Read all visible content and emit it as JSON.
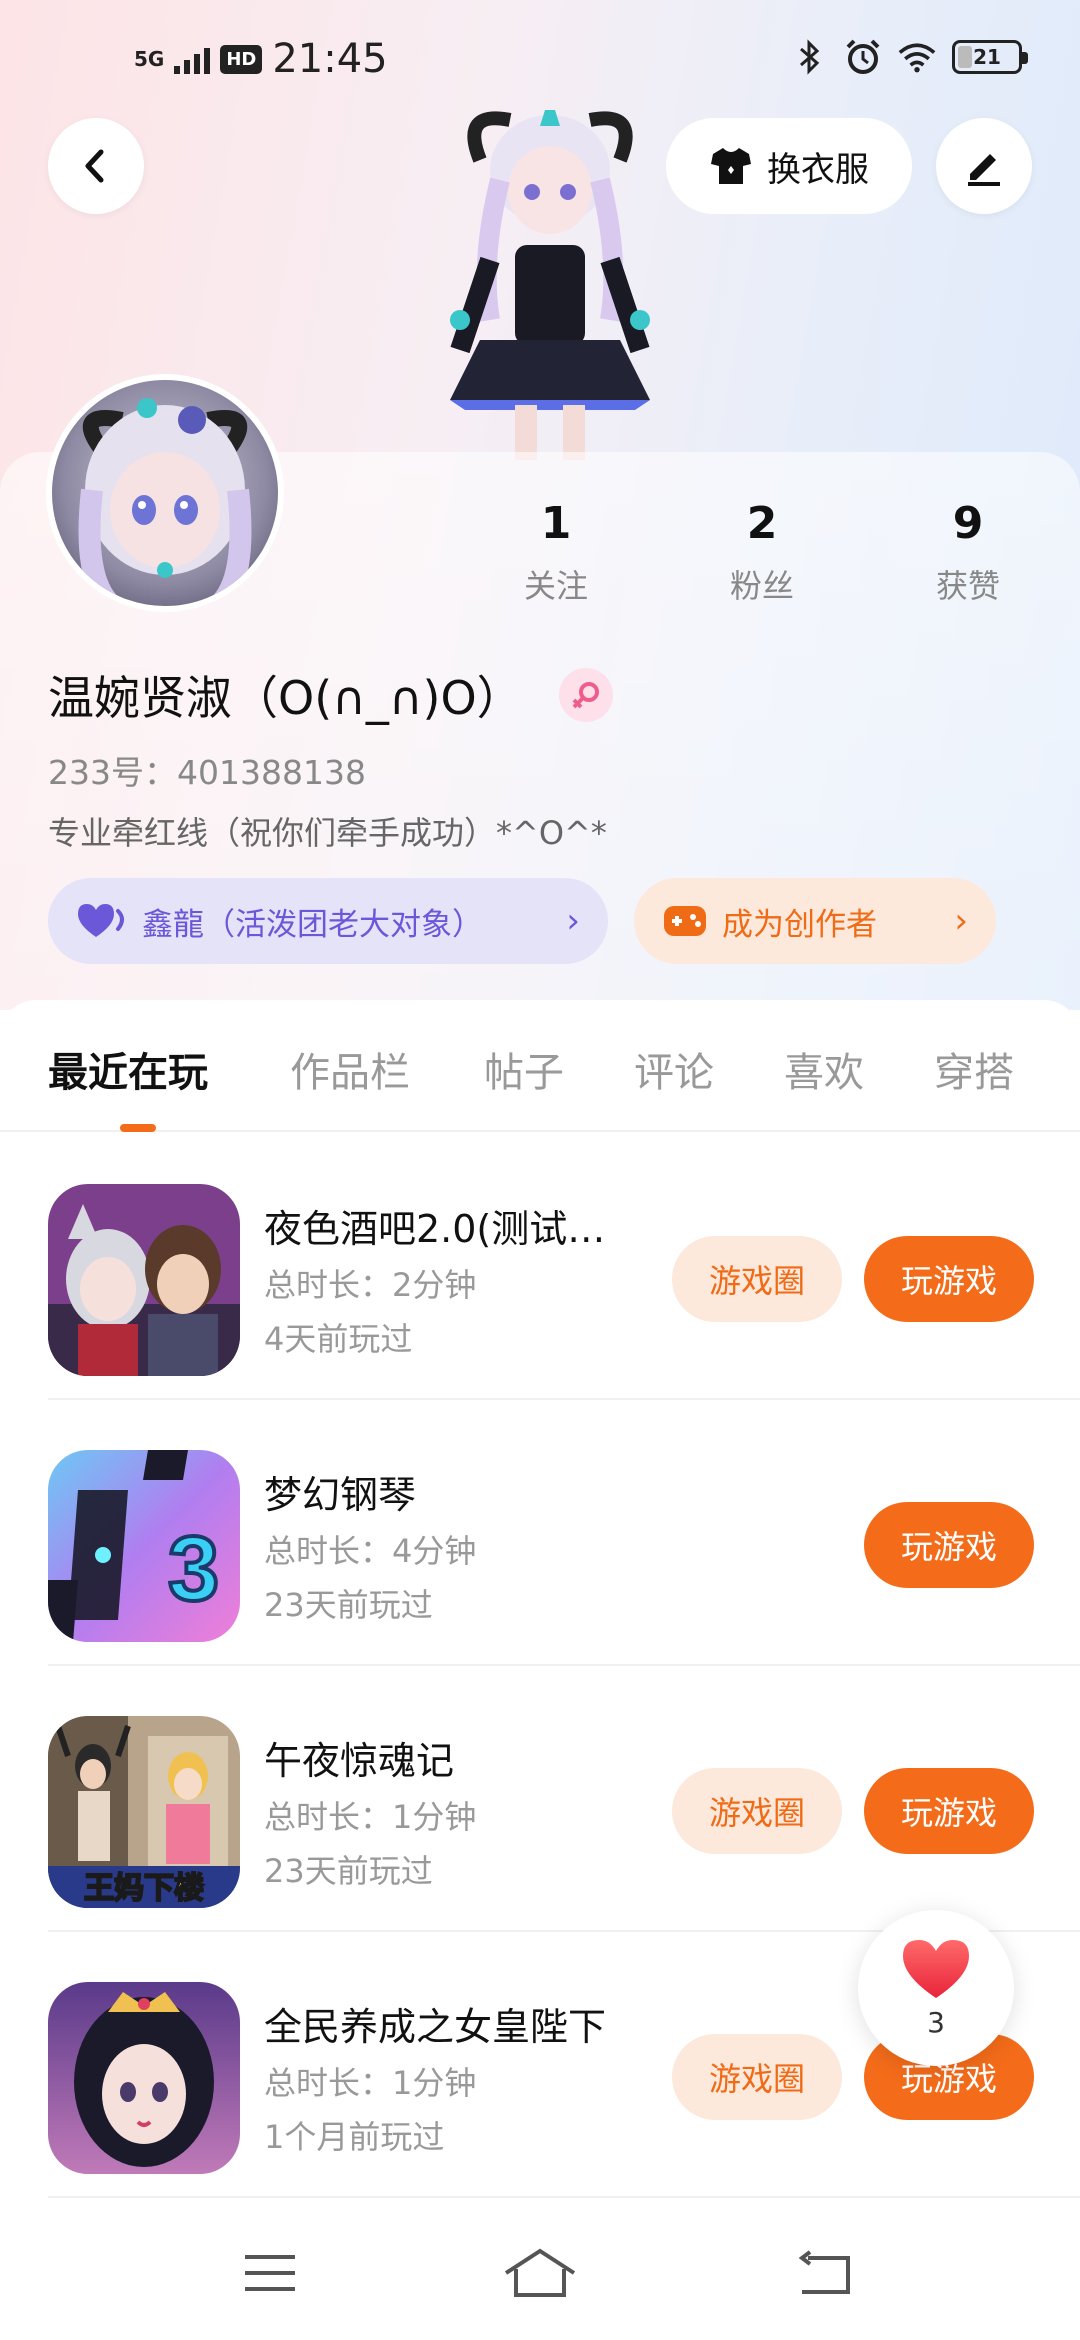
{
  "status_bar": {
    "signal": "5G",
    "hd": "HD",
    "time": "21:45",
    "battery": "21"
  },
  "header": {
    "outfit_label": "换衣服"
  },
  "profile": {
    "username": "温婉贤淑（O(∩_∩)O）",
    "uid": "233号：401388138",
    "bio": "专业牵红线（祝你们牵手成功）*^O^*",
    "stats": [
      {
        "value": "1",
        "label": "关注"
      },
      {
        "value": "2",
        "label": "粉丝"
      },
      {
        "value": "9",
        "label": "获赞"
      }
    ],
    "partner_pill": "鑫龍（活泼团老大对象）",
    "creator_pill": "成为创作者"
  },
  "tabs": [
    "最近在玩",
    "作品栏",
    "帖子",
    "评论",
    "喜欢",
    "穿搭"
  ],
  "games": [
    {
      "title": "夜色酒吧2.0(测试…",
      "duration": "总时长：2分钟",
      "last_played": "4天前玩过",
      "circle_label": "游戏圈",
      "play_label": "玩游戏"
    },
    {
      "title": "梦幻钢琴",
      "duration": "总时长：4分钟",
      "last_played": "23天前玩过",
      "play_label": "玩游戏"
    },
    {
      "title": "午夜惊魂记",
      "duration": "总时长：1分钟",
      "last_played": "23天前玩过",
      "circle_label": "游戏圈",
      "play_label": "玩游戏"
    },
    {
      "title": "全民养成之女皇陛下",
      "duration": "总时长：1分钟",
      "last_played": "1个月前玩过",
      "circle_label": "游戏圈",
      "play_label": "玩游戏"
    }
  ],
  "game_icon_texts": {
    "piano_number": "3",
    "horror_banner": "王妈下楼"
  },
  "like_float": {
    "count": "3"
  },
  "colors": {
    "accent": "#f46c1a",
    "accent_soft": "#fde8dc",
    "partner": "#6b58d9",
    "partner_soft": "#e5e3f8"
  }
}
